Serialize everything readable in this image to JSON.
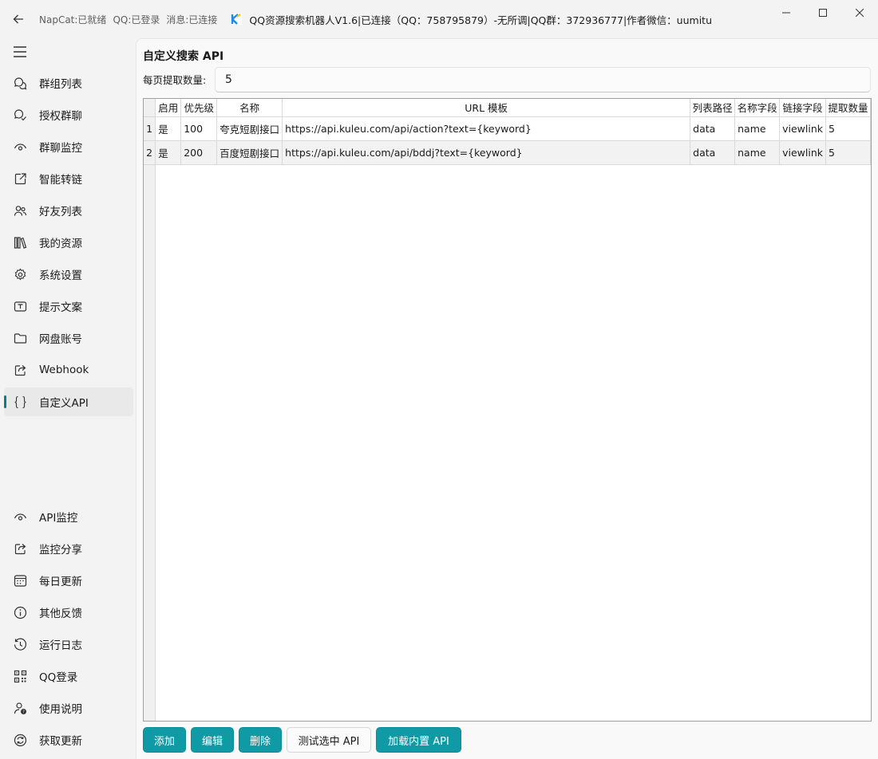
{
  "titlebar": {
    "napcat_status": "NapCat:已就绪",
    "qq_status": "QQ:已登录",
    "msg_status": "消息:已连接",
    "app_title": "QQ资源搜索机器人V1.6|已连接（QQ：758795879）-无所调|QQ群：372936777|作者微信：uumitu"
  },
  "sidebar": {
    "top_items": [
      {
        "label": "群组列表",
        "icon": "chat-bubbles-icon"
      },
      {
        "label": "授权群聊",
        "icon": "chat-check-icon"
      },
      {
        "label": "群聊监控",
        "icon": "eye-icon"
      },
      {
        "label": "智能转链",
        "icon": "external-link-icon"
      },
      {
        "label": "好友列表",
        "icon": "people-icon"
      },
      {
        "label": "我的资源",
        "icon": "library-icon"
      },
      {
        "label": "系统设置",
        "icon": "gear-icon"
      },
      {
        "label": "提示文案",
        "icon": "text-box-icon"
      },
      {
        "label": "网盘账号",
        "icon": "folder-icon"
      },
      {
        "label": "Webhook",
        "icon": "share-icon"
      },
      {
        "label": "自定义API",
        "icon": "braces-icon"
      }
    ],
    "bottom_items": [
      {
        "label": "API监控",
        "icon": "eye-icon"
      },
      {
        "label": "监控分享",
        "icon": "share-icon"
      },
      {
        "label": "每日更新",
        "icon": "calendar-icon"
      },
      {
        "label": "其他反馈",
        "icon": "info-icon"
      },
      {
        "label": "运行日志",
        "icon": "history-icon"
      },
      {
        "label": "QQ登录",
        "icon": "qr-code-icon"
      },
      {
        "label": "使用说明",
        "icon": "help-person-icon"
      },
      {
        "label": "获取更新",
        "icon": "sync-icon"
      }
    ]
  },
  "main": {
    "title": "自定义搜索 API",
    "per_page_label": "每页提取数量:",
    "per_page_value": "5",
    "table": {
      "headers": [
        "启用",
        "优先级",
        "名称",
        "URL 模板",
        "列表路径",
        "名称字段",
        "链接字段",
        "提取数量"
      ],
      "rows": [
        {
          "num": "1",
          "cells": [
            "是",
            "100",
            "夸克短剧接口",
            "https://api.kuleu.com/api/action?text={keyword}",
            "data",
            "name",
            "viewlink",
            "5"
          ]
        },
        {
          "num": "2",
          "cells": [
            "是",
            "200",
            "百度短剧接口",
            "https://api.kuleu.com/api/bddj?text={keyword}",
            "data",
            "name",
            "viewlink",
            "5"
          ]
        }
      ]
    },
    "buttons": {
      "add": "添加",
      "edit": "编辑",
      "delete": "删除",
      "test": "测试选中 API",
      "load": "加载内置 API"
    }
  },
  "colors": {
    "accent": "#0f9aa6",
    "active_indicator": "#0f7b8a"
  }
}
